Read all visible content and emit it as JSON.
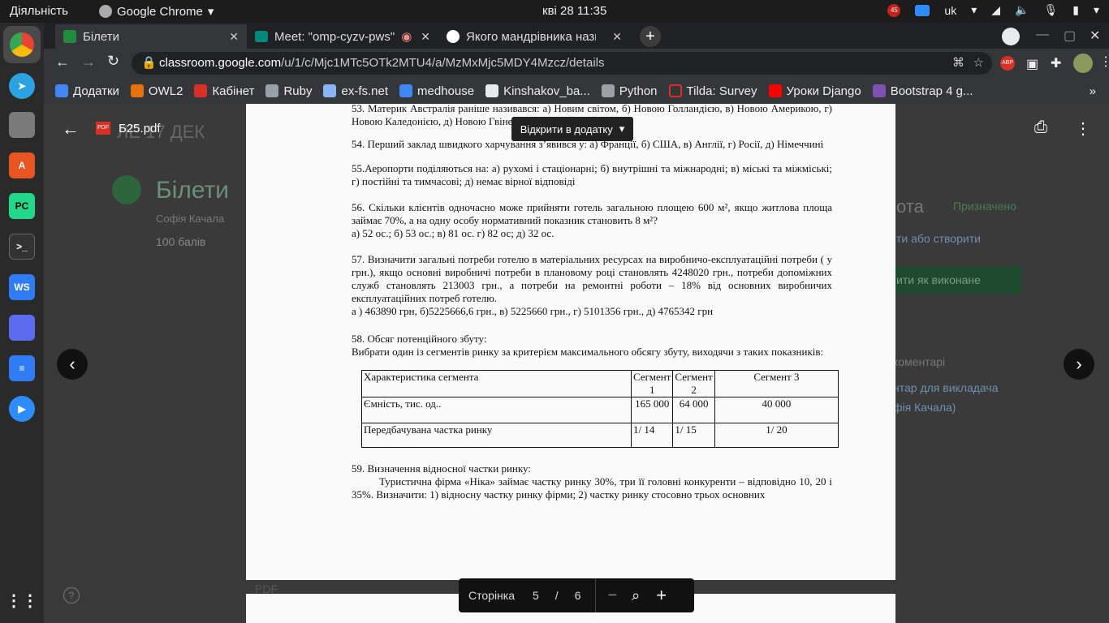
{
  "system": {
    "activities": "Діяльність",
    "app_name": "Google Chrome",
    "clock": "кві 28  11:35",
    "badge": "45",
    "lang": "uk"
  },
  "tabs": [
    {
      "label": "Білети",
      "icon": "classroom-icon"
    },
    {
      "label": "Meet: \"omp-cyzv-pws\"",
      "icon": "meet-icon"
    },
    {
      "label": "Якого мандрівника нази",
      "icon": "google-icon"
    }
  ],
  "omnibox": {
    "host": "classroom.google.com",
    "path": "/u/1/c/Mjc1MTc5OTk2MTU4/a/MzMxMjc5MDY4Mzcz/details"
  },
  "bookmarks": [
    {
      "label": "Додатки",
      "color": "#4285f4"
    },
    {
      "label": "OWL2",
      "color": "#e8710a"
    },
    {
      "label": "Кабінет",
      "color": "#d93025"
    },
    {
      "label": "Ruby",
      "color": "#9aa0a6"
    },
    {
      "label": "ex-fs.net",
      "color": "#8ab4f8"
    },
    {
      "label": "medhouse",
      "color": "#4285f4"
    },
    {
      "label": "Kinshakov_ba...",
      "color": "#e8eaed"
    },
    {
      "label": "Python",
      "color": "#9aa0a6"
    },
    {
      "label": "Tilda: Survey",
      "color": "#d93025"
    },
    {
      "label": "Уроки Django",
      "color": "#ff0000"
    },
    {
      "label": "Bootstrap 4 g...",
      "color": "#7952b3"
    }
  ],
  "viewer": {
    "file_name": "Б25.pdf",
    "open_in_app": "Відкрити в додатку",
    "page_label": "Сторінка",
    "current_page": "5",
    "separator": "/",
    "total_pages": "6"
  },
  "background": {
    "title": "Білети",
    "author": "Софія Качала",
    "points": "100 балів",
    "right1": "ота",
    "assigned": "Призначено",
    "add_create": "ти або створити",
    "mark_done": "ити як виконане",
    "comments": "коментарі",
    "private_comment": "нтар для викладача",
    "teacher": "фія Качала)",
    "fragment_title": "ЛЕ 17 ДЕК",
    "pdf_label": "PDF"
  },
  "doc": {
    "q53": "53. Материк Австралія раніше називався: а) Новим світом, б) Новою Голландією, в) Новою Америкою, г) Новою Каледонією, д) Новою Гвінеєю",
    "q54": "54. Перший заклад швидкого харчування з’явився у: а) Франції, б) США, в) Англії, г) Росії, д) Німеччині",
    "q55": "55.Аеропорти поділяються на: а) рухомі і стаціонарні; б) внутрішні та міжнародні; в) міські та міжміські; г) постійні та тимчасові; д) немає вірної відповіді",
    "q56": "56. Скільки клієнтів одночасно може прийняти готель загальною площею 600 м², якщо житлова площа займає 70%, а на одну особу нормативний показник становить 8 м²?",
    "q56a": "а) 52 ос.; б) 53 ос.; в) 81 ос. г) 82 ос; д) 32 ос.",
    "q57": "57. Визначити загальні потреби готелю в матеріальних ресурсах на виробничо-експлуатаційні потреби ( у грн.), якщо основні виробничі потреби в плановому році становлять 4248020 грн., потреби допоміжних служб становлять 213003 грн., а потреби на ремонтні роботи – 18% від основних виробничих експлуатаційних потреб готелю.",
    "q57a": "а ) 463890 грн, б)5225666,6 грн., в) 5225660 грн., г) 5101356 грн., д) 4765342 грн",
    "q58": "58. Обсяг потенційного збуту:",
    "q58b": "Вибрати один із сегментів ринку за критерієм максимального обсягу збуту, виходячи з таких показників:",
    "table": {
      "headers": [
        "Характеристика сегмента",
        "Сегмент 1",
        "Сегмент 2",
        "Сегмент 3"
      ],
      "row1": [
        "Ємність, тис. од..",
        "165 000",
        "64 000",
        "40 000"
      ],
      "row2": [
        "Передбачувана частка ринку",
        "1/ 14",
        "1/ 15",
        "1/ 20"
      ]
    },
    "q59": "59. Визначення відносної частки ринку:",
    "q59b": "Туристична фірма «Ніка» займає частку ринку 30%, три її головні конкуренти – відповідно 10, 20 і 35%. Визначити: 1) відносну частку ринку фірми; 2) частку ринку стосовно трьох основних"
  }
}
